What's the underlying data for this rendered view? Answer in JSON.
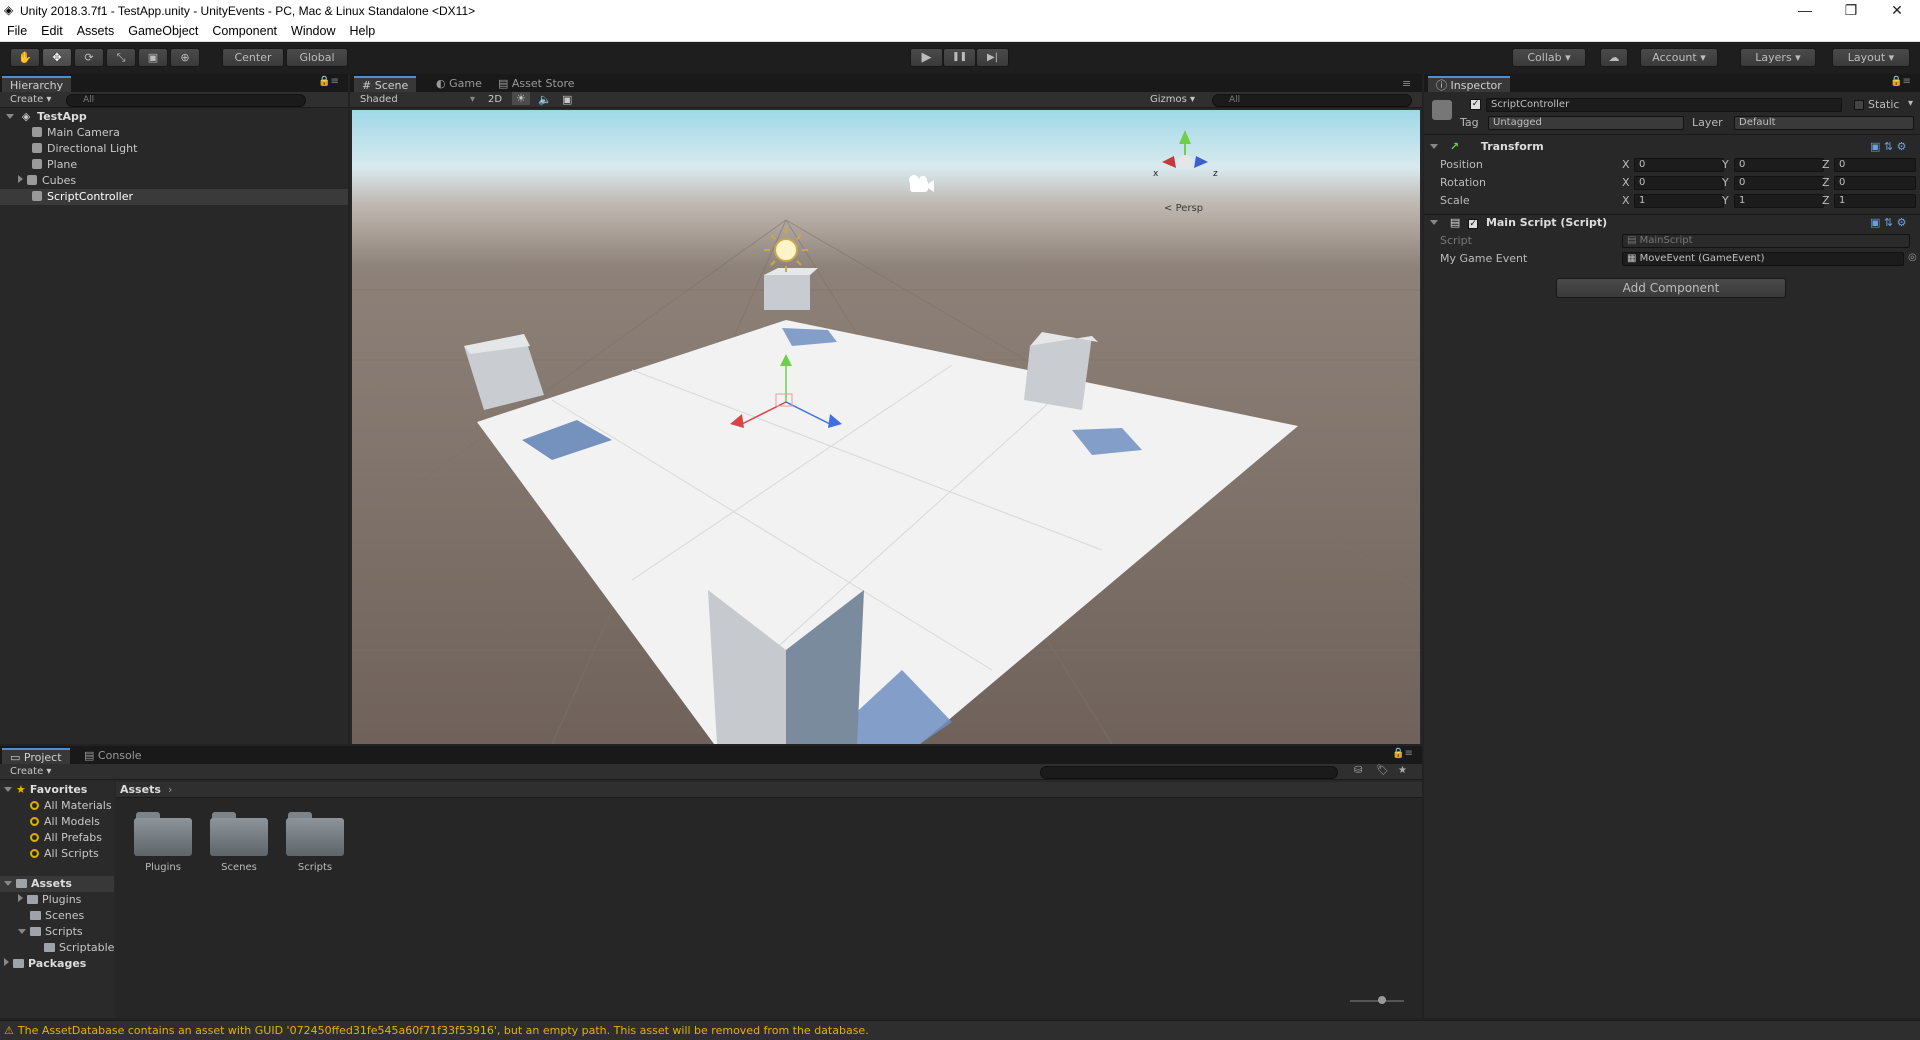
{
  "window": {
    "title": "Unity 2018.3.7f1 - TestApp.unity - UnityEvents - PC, Mac & Linux Standalone <DX11>",
    "minimize": "—",
    "restore": "❐",
    "close": "✕"
  },
  "menu": [
    "File",
    "Edit",
    "Assets",
    "GameObject",
    "Component",
    "Window",
    "Help"
  ],
  "toolbar": {
    "pivot": "Center",
    "space": "Global",
    "collab": "Collab ▾",
    "account": "Account ▾",
    "layers": "Layers ▾",
    "layout": "Layout ▾",
    "play": "▶",
    "pause": "❚❚",
    "step": "▶|"
  },
  "hierarchy": {
    "tab": "Hierarchy",
    "create": "Create ▾",
    "search_placeholder": "All",
    "scene": "TestApp",
    "items": [
      "Main Camera",
      "Directional Light",
      "Plane",
      "Cubes",
      "ScriptController"
    ]
  },
  "scene": {
    "tabs": [
      "Scene",
      "Game",
      "Asset Store"
    ],
    "shading": "Shaded",
    "mode2d": "2D",
    "gizmos": "Gizmos ▾",
    "search_placeholder": "All",
    "persp": "Persp",
    "gizmo_x": "x",
    "gizmo_z": "z"
  },
  "inspector": {
    "tab": "Inspector",
    "object_name": "ScriptController",
    "static_label": "Static",
    "tag_label": "Tag",
    "tag_value": "Untagged",
    "layer_label": "Layer",
    "layer_value": "Default",
    "transform": {
      "title": "Transform",
      "rows": [
        {
          "label": "Position",
          "x": "0",
          "y": "0",
          "z": "0"
        },
        {
          "label": "Rotation",
          "x": "0",
          "y": "0",
          "z": "0"
        },
        {
          "label": "Scale",
          "x": "1",
          "y": "1",
          "z": "1"
        }
      ],
      "axis_x": "X",
      "axis_y": "Y",
      "axis_z": "Z"
    },
    "script_component": {
      "title": "Main Script (Script)",
      "script_label": "Script",
      "script_value": "MainScript",
      "event_label": "My Game Event",
      "event_value": "MoveEvent (GameEvent)"
    },
    "add_component": "Add Component"
  },
  "project": {
    "tabs": [
      "Project",
      "Console"
    ],
    "create": "Create ▾",
    "favorites_label": "Favorites",
    "favorites": [
      "All Materials",
      "All Models",
      "All Prefabs",
      "All Scripts"
    ],
    "assets_label": "Assets",
    "tree": [
      "Plugins",
      "Scenes",
      "Scripts",
      "ScriptableObjects"
    ],
    "packages_label": "Packages",
    "breadcrumb": "Assets",
    "folders": [
      "Plugins",
      "Scenes",
      "Scripts"
    ]
  },
  "status": {
    "message": "The AssetDatabase contains an asset with GUID '072450ffed31fe545a60f71f33f53916', but an empty path. This asset will be removed from the database."
  },
  "colors": {
    "accent": "#4a8fd9",
    "warning": "#e8b400",
    "selection": "#3e5f8a"
  }
}
